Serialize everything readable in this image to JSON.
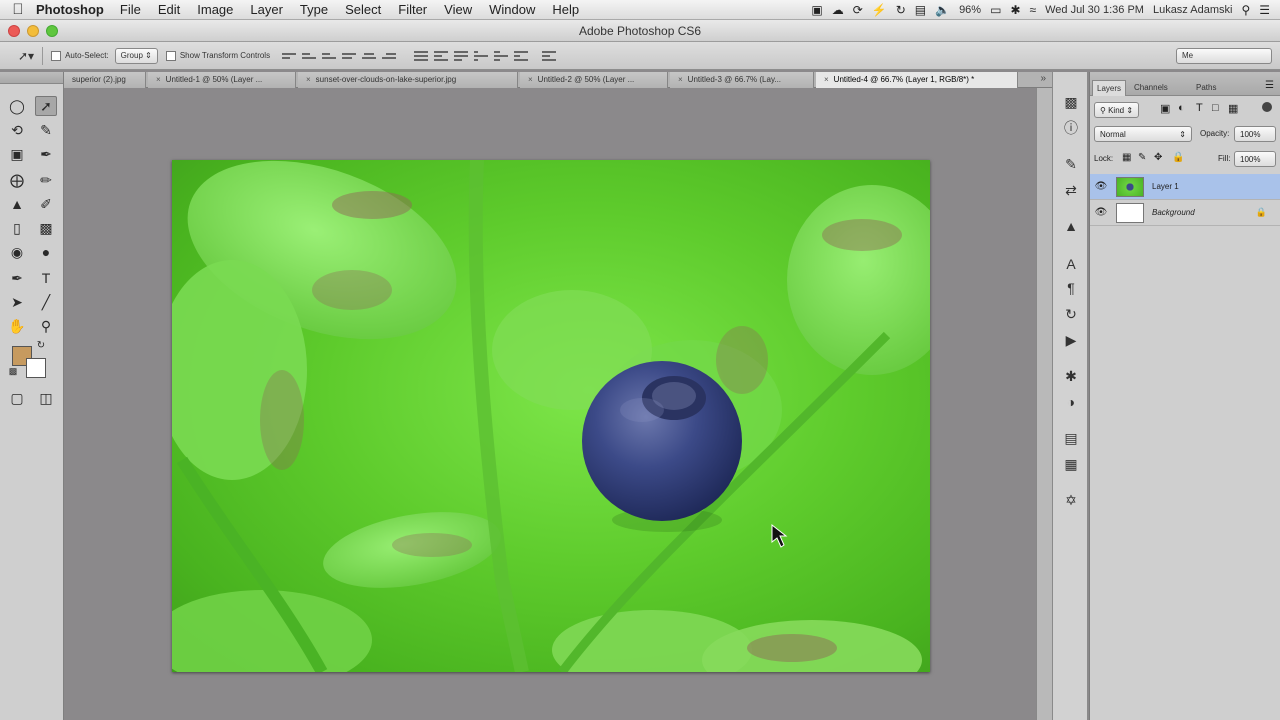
{
  "menubar": {
    "app_name": "Photoshop",
    "menus": [
      "File",
      "Edit",
      "Image",
      "Layer",
      "Type",
      "Select",
      "Filter",
      "View",
      "Window",
      "Help"
    ],
    "battery": "96%",
    "datetime": "Wed Jul 30  1:36 PM",
    "user": "Lukasz Adamski"
  },
  "window": {
    "title": "Adobe Photoshop CS6"
  },
  "options_bar": {
    "auto_select_label": "Auto-Select:",
    "auto_select_value": "Group",
    "show_transform_label": "Show Transform Controls",
    "workspace_value": "Me"
  },
  "doc_tabs": [
    "superior (2).jpg",
    "Untitled-1 @ 50% (Layer ...",
    "sunset-over-clouds-on-lake-superior.jpg",
    "Untitled-2 @ 50% (Layer ...",
    "Untitled-3 @ 66.7% (Lay...",
    "Untitled-4 @ 66.7% (Layer 1, RGB/8*) *"
  ],
  "layers_panel": {
    "tabs": [
      "Layers",
      "Channels",
      "Paths"
    ],
    "kind_filter": "Kind",
    "blend_mode": "Normal",
    "opacity_label": "Opacity:",
    "opacity_value": "100%",
    "lock_label": "Lock:",
    "fill_label": "Fill:",
    "fill_value": "100%",
    "layers": [
      "Layer 1",
      "Background"
    ]
  },
  "colors": {
    "foreground": "#c69a5f",
    "background": "#ffffff",
    "selected_layer": "#a9c2ea"
  }
}
